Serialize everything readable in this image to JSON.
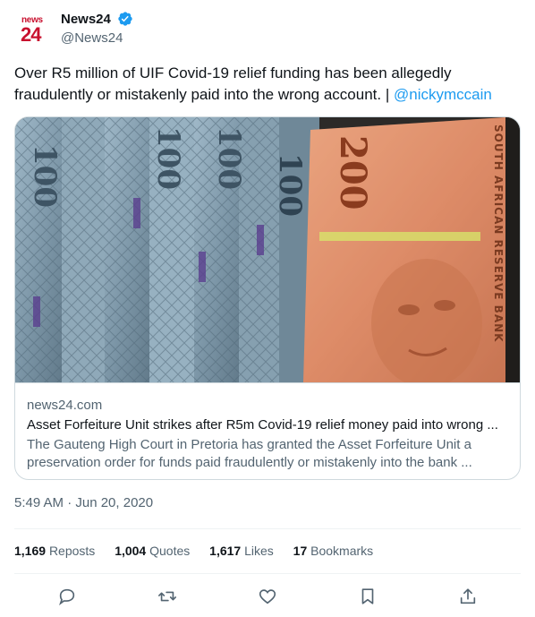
{
  "author": {
    "logo_small": "news",
    "logo_big": "24",
    "display_name": "News24",
    "handle": "@News24"
  },
  "tweet": {
    "text": "Over R5 million of UIF Covid-19 relief funding has been allegedly fraudulently or mistakenly paid into the wrong account. | ",
    "mention": "@nickymccain"
  },
  "card": {
    "banknote_labels": [
      "200",
      "SOUTH AFRICAN RESERVE BANK",
      "100",
      "100",
      "100",
      "100"
    ],
    "domain": "news24.com",
    "title": "Asset Forfeiture Unit strikes after R5m Covid-19 relief money paid into wrong ...",
    "description": "The Gauteng High Court in Pretoria has granted the Asset Forfeiture Unit a preservation order for funds paid fraudulently or mistakenly into the bank ..."
  },
  "timestamp": "5:49 AM · Jun 20, 2020",
  "stats": {
    "reposts_count": "1,169",
    "reposts_label": "Reposts",
    "quotes_count": "1,004",
    "quotes_label": "Quotes",
    "likes_count": "1,617",
    "likes_label": "Likes",
    "bookmarks_count": "17",
    "bookmarks_label": "Bookmarks"
  },
  "colors": {
    "accent": "#1d9bf0",
    "brand": "#c8102e",
    "secondary_text": "#536471"
  },
  "icons": [
    "verified-badge-icon",
    "reply-icon",
    "repost-icon",
    "like-icon",
    "bookmark-icon",
    "share-icon"
  ]
}
